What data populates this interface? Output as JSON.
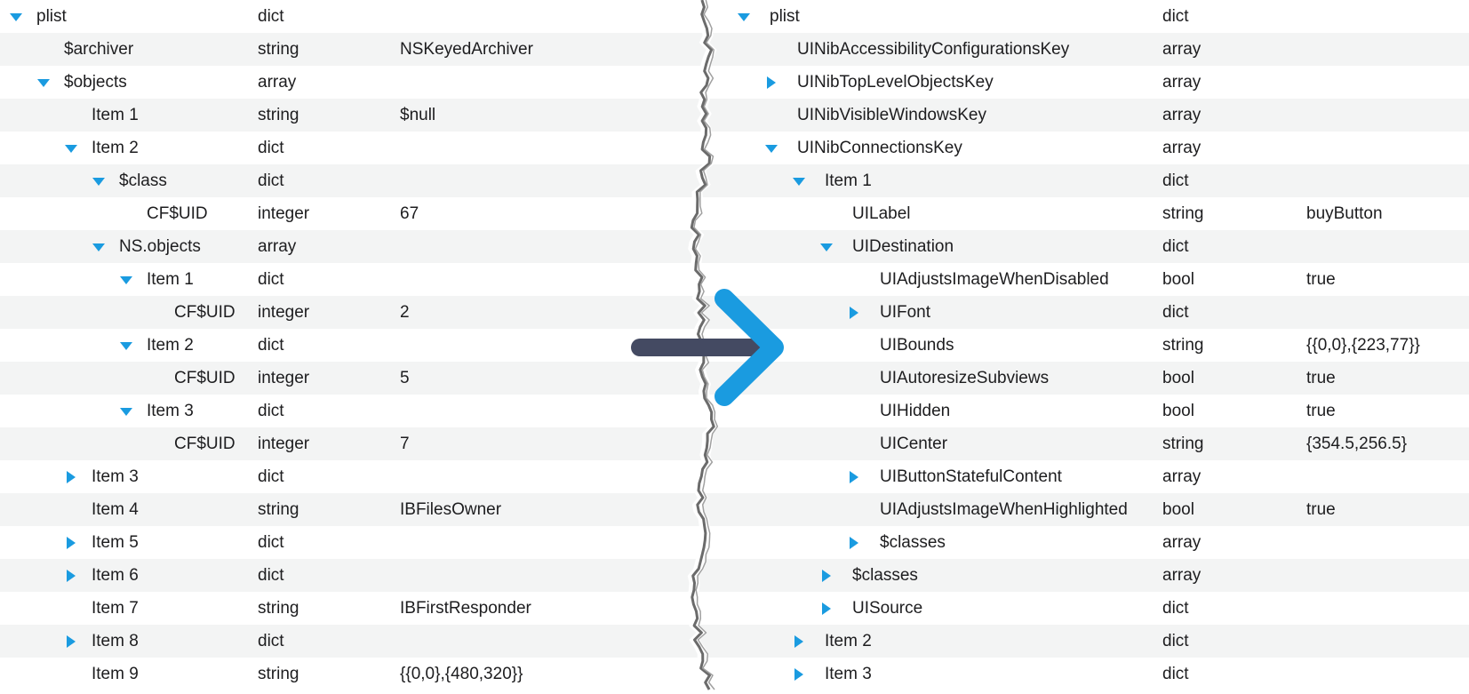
{
  "colors": {
    "accent": "#1a9be0",
    "arrow_shaft": "#444a62",
    "row_alt": "#f3f4f4",
    "text": "#1d1d1f"
  },
  "icons": {
    "expanded": "disclosure-triangle-down-icon",
    "collapsed": "disclosure-triangle-right-icon",
    "divider": "right-arrow-icon"
  },
  "left_rows": [
    {
      "level": 0,
      "disc": "open",
      "key": "plist",
      "type": "dict",
      "value": ""
    },
    {
      "level": 1,
      "disc": "none",
      "key": "$archiver",
      "type": "string",
      "value": "NSKeyedArchiver"
    },
    {
      "level": 1,
      "disc": "open",
      "key": "$objects",
      "type": "array",
      "value": ""
    },
    {
      "level": 2,
      "disc": "none",
      "key": "Item 1",
      "type": "string",
      "value": "$null"
    },
    {
      "level": 2,
      "disc": "open",
      "key": "Item 2",
      "type": "dict",
      "value": ""
    },
    {
      "level": 3,
      "disc": "open",
      "key": "$class",
      "type": "dict",
      "value": ""
    },
    {
      "level": 4,
      "disc": "none",
      "key": "CF$UID",
      "type": "integer",
      "value": "67"
    },
    {
      "level": 3,
      "disc": "open",
      "key": "NS.objects",
      "type": "array",
      "value": ""
    },
    {
      "level": 4,
      "disc": "open",
      "key": "Item 1",
      "type": "dict",
      "value": ""
    },
    {
      "level": 5,
      "disc": "none",
      "key": "CF$UID",
      "type": "integer",
      "value": "2"
    },
    {
      "level": 4,
      "disc": "open",
      "key": "Item 2",
      "type": "dict",
      "value": ""
    },
    {
      "level": 5,
      "disc": "none",
      "key": "CF$UID",
      "type": "integer",
      "value": "5"
    },
    {
      "level": 4,
      "disc": "open",
      "key": "Item 3",
      "type": "dict",
      "value": ""
    },
    {
      "level": 5,
      "disc": "none",
      "key": "CF$UID",
      "type": "integer",
      "value": "7"
    },
    {
      "level": 2,
      "disc": "closed",
      "key": "Item 3",
      "type": "dict",
      "value": ""
    },
    {
      "level": 2,
      "disc": "none",
      "key": "Item 4",
      "type": "string",
      "value": "IBFilesOwner"
    },
    {
      "level": 2,
      "disc": "closed",
      "key": "Item 5",
      "type": "dict",
      "value": ""
    },
    {
      "level": 2,
      "disc": "closed",
      "key": "Item 6",
      "type": "dict",
      "value": ""
    },
    {
      "level": 2,
      "disc": "none",
      "key": "Item 7",
      "type": "string",
      "value": "IBFirstResponder"
    },
    {
      "level": 2,
      "disc": "closed",
      "key": "Item 8",
      "type": "dict",
      "value": ""
    },
    {
      "level": 2,
      "disc": "none",
      "key": "Item 9",
      "type": "string",
      "value": "{{0,0},{480,320}}"
    }
  ],
  "right_rows": [
    {
      "level": 0,
      "disc": "open",
      "key": "plist",
      "type": "dict",
      "value": ""
    },
    {
      "level": 1,
      "disc": "none",
      "key": "UINibAccessibilityConfigurationsKey",
      "type": "array",
      "value": ""
    },
    {
      "level": 1,
      "disc": "closed",
      "key": "UINibTopLevelObjectsKey",
      "type": "array",
      "value": ""
    },
    {
      "level": 1,
      "disc": "none",
      "key": "UINibVisibleWindowsKey",
      "type": "array",
      "value": ""
    },
    {
      "level": 1,
      "disc": "open",
      "key": "UINibConnectionsKey",
      "type": "array",
      "value": ""
    },
    {
      "level": 2,
      "disc": "open",
      "key": "Item 1",
      "type": "dict",
      "value": ""
    },
    {
      "level": 3,
      "disc": "none",
      "key": "UILabel",
      "type": "string",
      "value": "buyButton"
    },
    {
      "level": 3,
      "disc": "open",
      "key": "UIDestination",
      "type": "dict",
      "value": ""
    },
    {
      "level": 4,
      "disc": "none",
      "key": "UIAdjustsImageWhenDisabled",
      "type": "bool",
      "value": "true"
    },
    {
      "level": 4,
      "disc": "closed",
      "key": "UIFont",
      "type": "dict",
      "value": ""
    },
    {
      "level": 4,
      "disc": "none",
      "key": "UIBounds",
      "type": "string",
      "value": "{{0,0},{223,77}}"
    },
    {
      "level": 4,
      "disc": "none",
      "key": "UIAutoresizeSubviews",
      "type": "bool",
      "value": "true"
    },
    {
      "level": 4,
      "disc": "none",
      "key": "UIHidden",
      "type": "bool",
      "value": "true"
    },
    {
      "level": 4,
      "disc": "none",
      "key": "UICenter",
      "type": "string",
      "value": "{354.5,256.5}"
    },
    {
      "level": 4,
      "disc": "closed",
      "key": "UIButtonStatefulContent",
      "type": "array",
      "value": ""
    },
    {
      "level": 4,
      "disc": "none",
      "key": "UIAdjustsImageWhenHighlighted",
      "type": "bool",
      "value": "true"
    },
    {
      "level": 4,
      "disc": "closed",
      "key": "$classes",
      "type": "array",
      "value": ""
    },
    {
      "level": 3,
      "disc": "closed",
      "key": "$classes",
      "type": "array",
      "value": ""
    },
    {
      "level": 3,
      "disc": "closed",
      "key": "UISource",
      "type": "dict",
      "value": ""
    },
    {
      "level": 2,
      "disc": "closed",
      "key": "Item 2",
      "type": "dict",
      "value": ""
    },
    {
      "level": 2,
      "disc": "closed",
      "key": "Item 3",
      "type": "dict",
      "value": ""
    }
  ]
}
